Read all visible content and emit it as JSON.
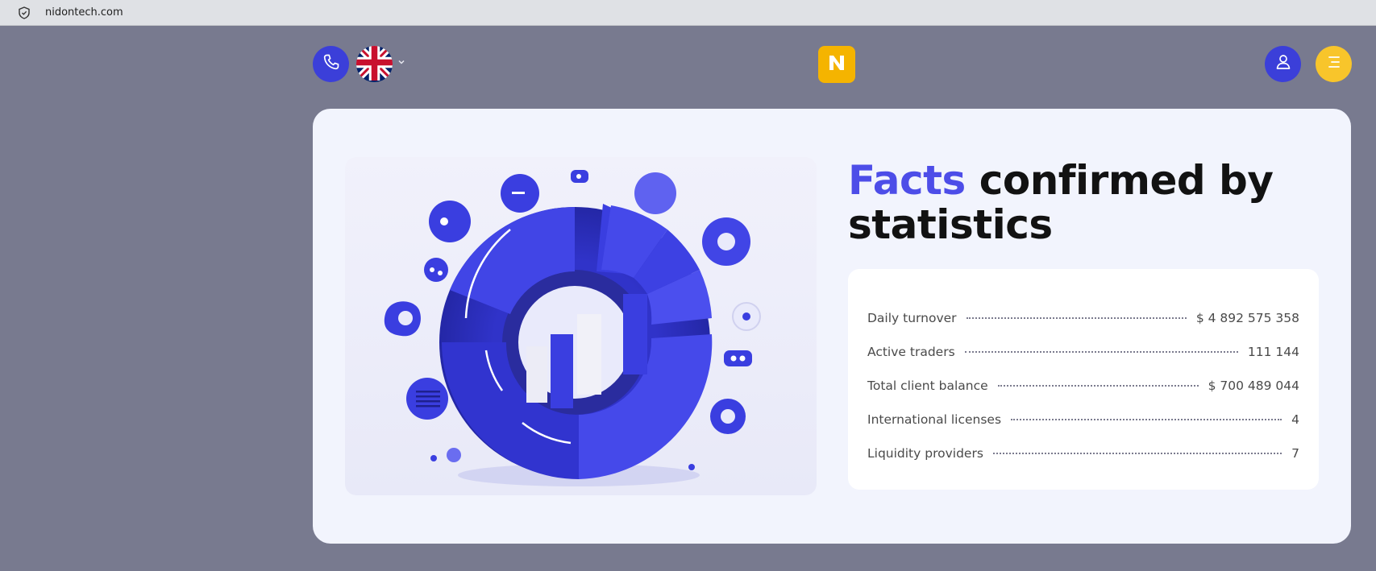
{
  "browser": {
    "url": "nidontech.com",
    "site_icon": "shield-icon"
  },
  "header": {
    "phone_icon": "phone-icon",
    "language_flag": "uk-flag-icon",
    "language_caret": "chevron-down-icon",
    "logo_letter": "N",
    "user_icon": "user-icon",
    "menu_icon": "menu-icon"
  },
  "colors": {
    "accent_blue": "#3b3fd9",
    "accent_yellow": "#f5b400",
    "heading_accent": "#4d4de8"
  },
  "facts": {
    "title_accent": "Facts",
    "title_rest": "confirmed by statistics",
    "stats": [
      {
        "label": "Daily turnover",
        "value": "$ 4 892 575 358"
      },
      {
        "label": "Active traders",
        "value": "111 144"
      },
      {
        "label": "Total client balance",
        "value": "$ 700 489 044"
      },
      {
        "label": "International licenses",
        "value": "4"
      },
      {
        "label": "Liquidity providers",
        "value": "7"
      }
    ]
  }
}
